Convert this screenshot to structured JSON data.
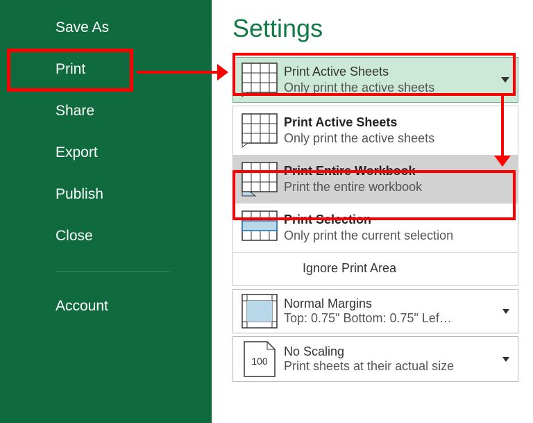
{
  "sidebar": {
    "items": [
      {
        "label": "Save As"
      },
      {
        "label": "Print"
      },
      {
        "label": "Share"
      },
      {
        "label": "Export"
      },
      {
        "label": "Publish"
      },
      {
        "label": "Close"
      },
      {
        "label": "Account"
      }
    ]
  },
  "settings": {
    "title": "Settings",
    "selected": {
      "title": "Print Active Sheets",
      "desc": "Only print the active sheets"
    },
    "options": [
      {
        "title": "Print Active Sheets",
        "desc": "Only print the active sheets"
      },
      {
        "title": "Print Entire Workbook",
        "desc": "Print the entire workbook"
      },
      {
        "title": "Print Selection",
        "desc": "Only print the current selection"
      }
    ],
    "ignore": "Ignore Print Area",
    "margins": {
      "title": "Normal Margins",
      "desc": "Top: 0.75\" Bottom: 0.75\" Lef…"
    },
    "scaling": {
      "title": "No Scaling",
      "desc": "Print sheets at their actual size",
      "num": "100"
    }
  }
}
